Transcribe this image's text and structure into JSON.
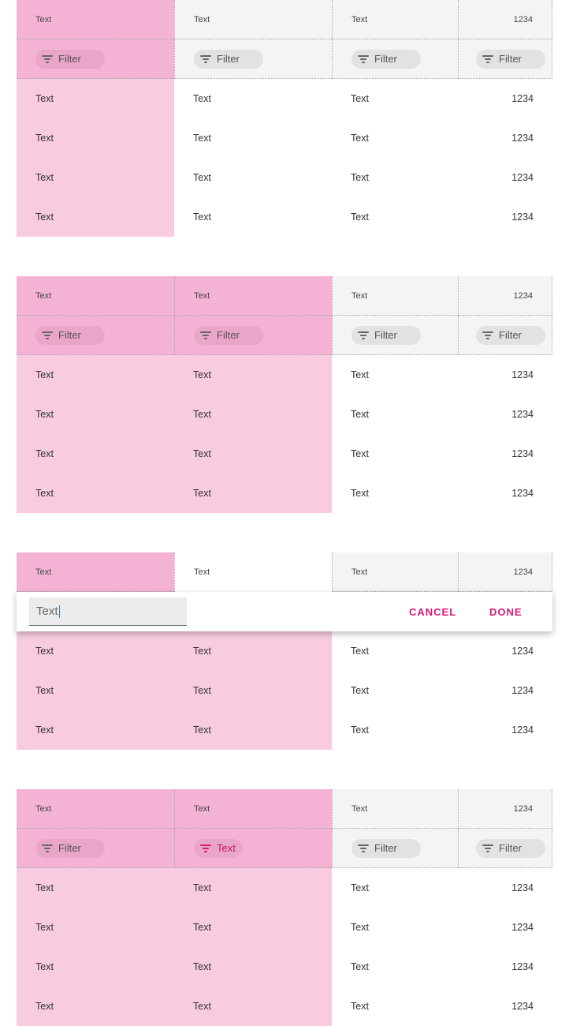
{
  "colors": {
    "accent": "#d81b78",
    "selected_header": "#f4b3d5",
    "selected_cell": "#f8cbe1",
    "header_bg": "#f4f4f4"
  },
  "table1": {
    "headers": [
      "Text",
      "Text",
      "Text",
      "1234"
    ],
    "filters": [
      "Filter",
      "Filter",
      "Filter",
      "Filter"
    ],
    "rows": [
      [
        "Text",
        "Text",
        "Text",
        "1234"
      ],
      [
        "Text",
        "Text",
        "Text",
        "1234"
      ],
      [
        "Text",
        "Text",
        "Text",
        "1234"
      ],
      [
        "Text",
        "Text",
        "Text",
        "1234"
      ]
    ]
  },
  "table2": {
    "headers": [
      "Text",
      "Text",
      "Text",
      "1234"
    ],
    "filters": [
      "Filter",
      "Filter",
      "Filter",
      "Filter"
    ],
    "rows": [
      [
        "Text",
        "Text",
        "Text",
        "1234"
      ],
      [
        "Text",
        "Text",
        "Text",
        "1234"
      ],
      [
        "Text",
        "Text",
        "Text",
        "1234"
      ],
      [
        "Text",
        "Text",
        "Text",
        "1234"
      ]
    ]
  },
  "table3": {
    "headers": [
      "Text",
      "Text",
      "Text",
      "1234"
    ],
    "edit": {
      "value": "Text",
      "cancel_label": "CANCEL",
      "done_label": "DONE"
    },
    "rows": [
      [
        "Text",
        "Text",
        "Text",
        "1234"
      ],
      [
        "Text",
        "Text",
        "Text",
        "1234"
      ],
      [
        "Text",
        "Text",
        "Text",
        "1234"
      ]
    ]
  },
  "table4": {
    "headers": [
      "Text",
      "Text",
      "Text",
      "1234"
    ],
    "filters": [
      "Filter",
      "Text",
      "Filter",
      "Filter"
    ],
    "rows": [
      [
        "Text",
        "Text",
        "Text",
        "1234"
      ],
      [
        "Text",
        "Text",
        "Text",
        "1234"
      ],
      [
        "Text",
        "Text",
        "Text",
        "1234"
      ],
      [
        "Text",
        "Text",
        "Text",
        "1234"
      ]
    ]
  }
}
